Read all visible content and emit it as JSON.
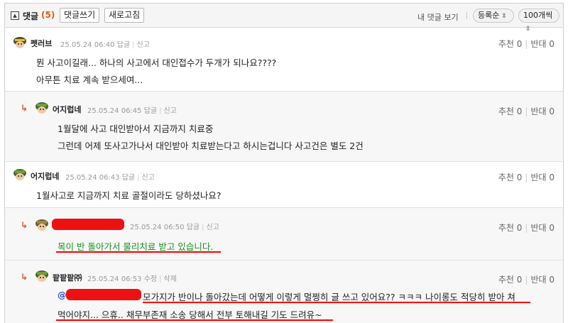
{
  "header": {
    "toggle_glyph": "▲",
    "title": "댓글",
    "count": "(5)",
    "write_label": "댓글쓰기",
    "refresh_label": "새로고침",
    "my_comments_label": "내 댓글 보기",
    "sort_value": "등록순",
    "per_page_value": "100개씩",
    "chevron_glyph": "⌃⌄"
  },
  "comments": [
    {
      "nick": "펫러브",
      "datetime": "25.05.24 06:40",
      "reply_label": "답글",
      "report_label": "신고",
      "lines": [
        "뭔 사고이길래... 하나의 사고에서 대인접수가 두개가 되나요????",
        "아무튼 치료 계속 받으세여..."
      ],
      "recommend": "추천 0",
      "oppose": "반대 0"
    },
    {
      "nick": "어지럽네",
      "datetime": "25.05.24 06:45",
      "reply_label": "답글",
      "report_label": "신고",
      "lines": [
        "1월달에 사고 대인받아서 지금까지 치료중",
        "그런데 어제 또사고가나서 대인받아 치료받는다고 하시는겁니다 사고건은 별도 2건"
      ],
      "recommend": "추천 0",
      "oppose": "반대 0"
    },
    {
      "nick": "어지럽네",
      "datetime": "25.05.24 06:43",
      "reply_label": "답글",
      "report_label": "신고",
      "lines": [
        "1월사고로 지금까지 치료 골절이라도 당하셨나요?"
      ],
      "recommend": "추천 0",
      "oppose": "반대 0"
    },
    {
      "nick": "",
      "datetime": "25.05.24 06:50",
      "reply_label": "답글",
      "report_label": "신고",
      "lines": [
        "목이 반 돌아가서 물리치료 받고 있습니다."
      ],
      "recommend": "추천 0",
      "oppose": "반대 0"
    },
    {
      "nick": "팥팥팥㈜",
      "datetime": "25.05.24 06:53",
      "edit_label": "수정",
      "delete_label": "삭제",
      "mention_prefix": "@",
      "lines": [
        "모가지가 반이나 돌아갔는데 어떻게 이렇게 멀쩡히 글 쓰고 있어요?? ㅋㅋㅋ 나이롱도 적당히 받아 쳐",
        "먹어야지... 으휴.. 채무부존재 소송 당해서 전부 토해내길 기도 드려유~"
      ],
      "recommend": "추천 0",
      "oppose": "반대 0"
    }
  ],
  "reply_arrow": "↳",
  "colors": {
    "accent": "#e05a13",
    "redaction": "#ee1111",
    "green_text": "#1a8f1a",
    "mention": "#2a4dc0"
  },
  "icons": [
    "collapse-toggle-icon",
    "user-avatar-icon",
    "reply-arrow-icon",
    "chevron-updown-icon"
  ]
}
